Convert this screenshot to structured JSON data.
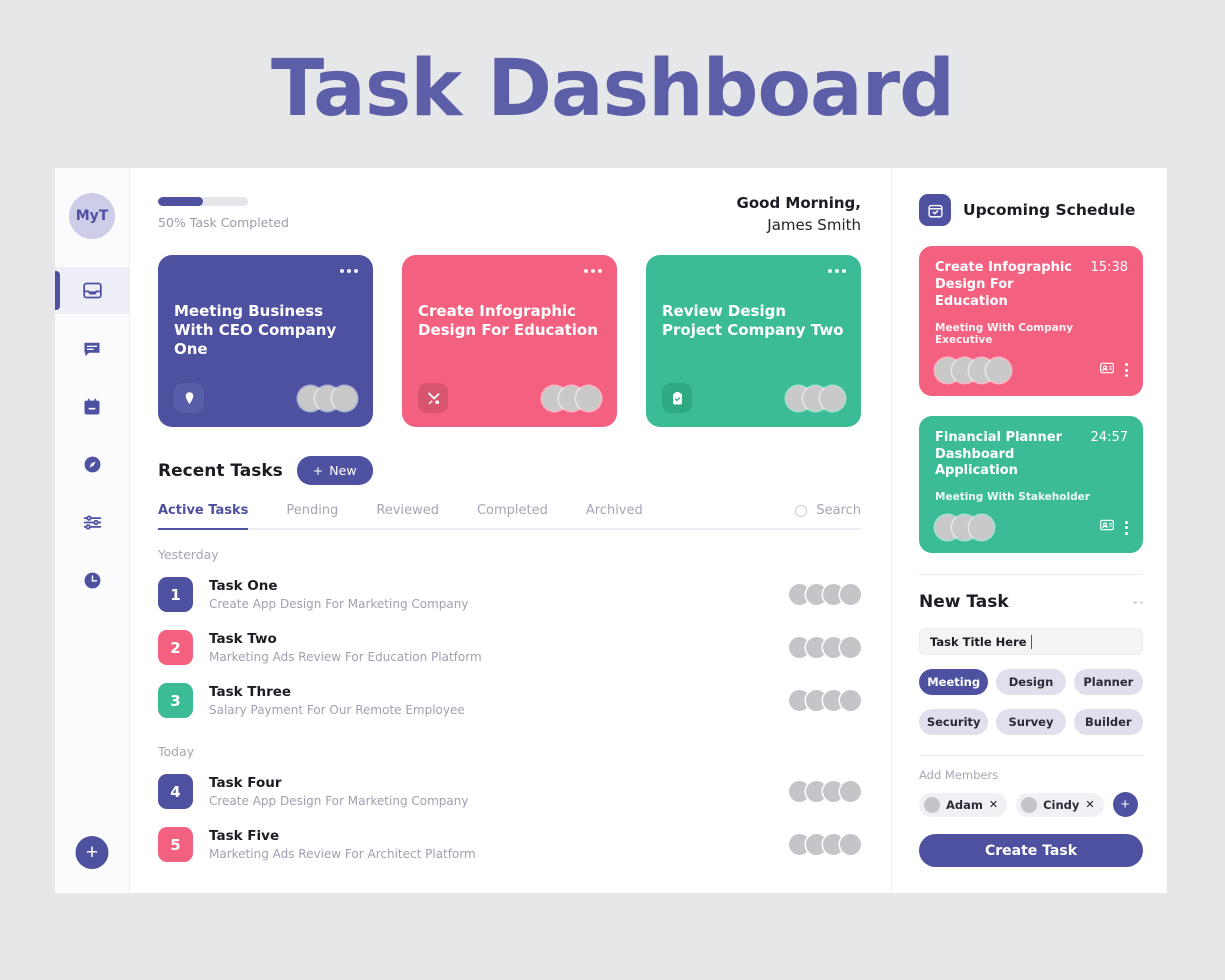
{
  "page": {
    "title": "Task Dashboard",
    "accent": "#4d51a0",
    "pink": "#f4607f",
    "green": "#3cbc96"
  },
  "sidebar": {
    "logo": "MyT",
    "items": [
      {
        "name": "inbox",
        "label": "Inbox"
      },
      {
        "name": "messages",
        "label": "Messages"
      },
      {
        "name": "calendar",
        "label": "Calendar"
      },
      {
        "name": "explore",
        "label": "Explore"
      },
      {
        "name": "settings",
        "label": "Settings"
      },
      {
        "name": "history",
        "label": "History"
      }
    ],
    "add_label": "+"
  },
  "header": {
    "progress_percent": 50,
    "progress_label": "50% Task Completed",
    "greeting_line1": "Good Morning,",
    "greeting_line2": "James Smith"
  },
  "feature_cards": [
    {
      "title": "Meeting Business With CEO Company One",
      "color": "#4d51a0",
      "icon_bg": "#5a5eaa",
      "icon": "location-pin-icon",
      "avatars": 3,
      "menu": "more-icon"
    },
    {
      "title": "Create Infographic Design For Education",
      "color": "#f4607f",
      "icon_bg": "#d9546f",
      "icon": "tools-icon",
      "avatars": 3,
      "menu": "more-icon"
    },
    {
      "title": "Review Design Project Company Two",
      "color": "#3cbc96",
      "icon_bg": "#2fa984",
      "icon": "clipboard-check-icon",
      "avatars": 3,
      "menu": "more-icon"
    }
  ],
  "recent": {
    "title": "Recent Tasks",
    "new_button": "New",
    "new_button_icon": "+",
    "tabs": [
      {
        "label": "Active Tasks",
        "active": true
      },
      {
        "label": "Pending",
        "active": false
      },
      {
        "label": "Reviewed",
        "active": false
      },
      {
        "label": "Completed",
        "active": false
      },
      {
        "label": "Archived",
        "active": false
      }
    ],
    "search_label": "Search",
    "groups": [
      {
        "day": "Yesterday",
        "tasks": [
          {
            "number": "1",
            "name": "Task One",
            "desc": "Create App Design For Marketing Company",
            "color": "#4d51a0",
            "avatars": 4
          },
          {
            "number": "2",
            "name": "Task Two",
            "desc": "Marketing Ads Review For Education Platform",
            "color": "#f4607f",
            "avatars": 4
          },
          {
            "number": "3",
            "name": "Task Three",
            "desc": "Salary Payment For Our Remote Employee",
            "color": "#3cbc96",
            "avatars": 4
          }
        ]
      },
      {
        "day": "Today",
        "tasks": [
          {
            "number": "4",
            "name": "Task Four",
            "desc": "Create App Design For Marketing Company",
            "color": "#4d51a0",
            "avatars": 4
          },
          {
            "number": "5",
            "name": "Task Five",
            "desc": "Marketing Ads Review For Architect Platform",
            "color": "#f4607f",
            "avatars": 4
          }
        ]
      }
    ]
  },
  "schedule": {
    "title": "Upcoming Schedule",
    "icon": "calendar-icon",
    "cards": [
      {
        "title": "Create Infographic Design For Education",
        "time": "15:38",
        "subtitle": "Meeting With Company Executive",
        "color": "#f4607f",
        "avatars": 4,
        "action_icon": "contact-card-icon",
        "menu_icon": "more-vertical-icon"
      },
      {
        "title": "Financial Planner Dashboard Application",
        "time": "24:57",
        "subtitle": "Meeting With Stakeholder",
        "color": "#3cbc96",
        "avatars": 3,
        "action_icon": "contact-card-icon",
        "menu_icon": "more-vertical-icon"
      }
    ]
  },
  "new_task": {
    "title": "New Task",
    "menu_icon": "more-icon",
    "input_value": "Task Title Here",
    "input_placeholder": "Task Title Here",
    "chips": [
      {
        "label": "Meeting",
        "active": true
      },
      {
        "label": "Design",
        "active": false
      },
      {
        "label": "Planner",
        "active": false
      },
      {
        "label": "Security",
        "active": false
      },
      {
        "label": "Survey",
        "active": false
      },
      {
        "label": "Builder",
        "active": false
      }
    ],
    "add_members_label": "Add Members",
    "members": [
      {
        "name": "Adam",
        "remove": "✕"
      },
      {
        "name": "Cindy",
        "remove": "✕"
      }
    ],
    "add_member_icon": "+",
    "submit_label": "Create Task"
  }
}
